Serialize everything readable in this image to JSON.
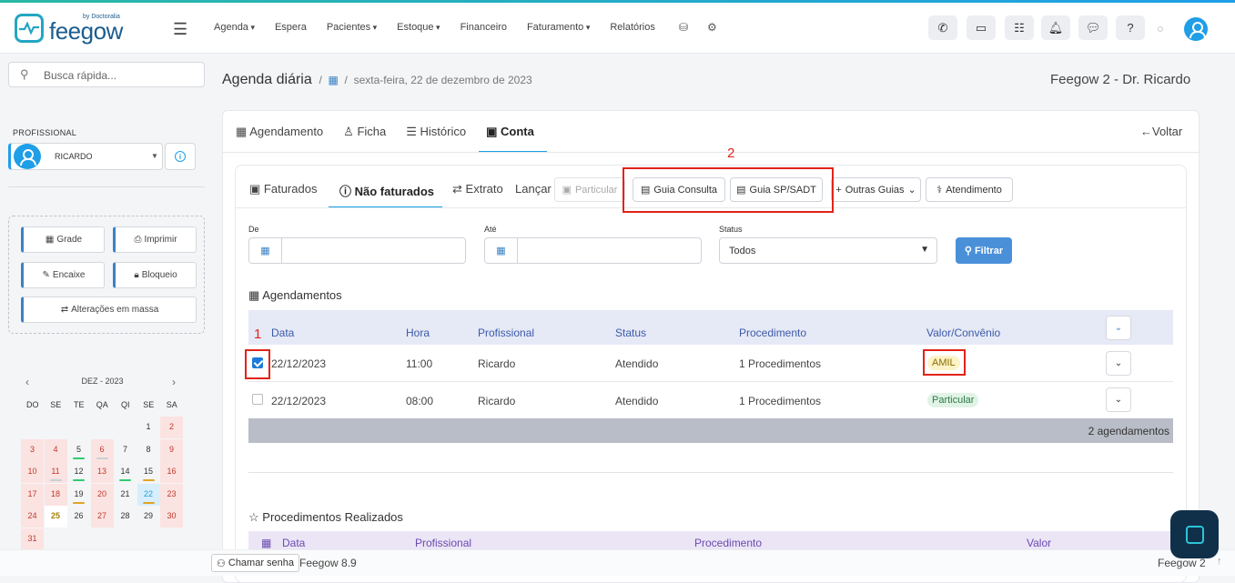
{
  "brand": {
    "name": "feegow",
    "by": "by Doctoralia"
  },
  "nav": {
    "items": [
      {
        "label": "Agenda",
        "caret": true
      },
      {
        "label": "Espera",
        "caret": false
      },
      {
        "label": "Pacientes",
        "caret": true
      },
      {
        "label": "Estoque",
        "caret": true
      },
      {
        "label": "Financeiro",
        "caret": false
      },
      {
        "label": "Faturamento",
        "caret": true
      },
      {
        "label": "Relatórios",
        "caret": false
      }
    ]
  },
  "topbar_icons": [
    "phone-icon",
    "inbox-icon",
    "tasks-icon",
    "bell-icon",
    "chat-icon",
    "help-icon"
  ],
  "sidebar": {
    "search_placeholder": "Busca rápida...",
    "prof_label": "PROFISSIONAL",
    "prof_name": "RICARDO",
    "actions": {
      "grade": "Grade",
      "imprimir": "Imprimir",
      "encaixe": "Encaixe",
      "bloqueio": "Bloqueio",
      "massa": "Alterações em massa"
    },
    "calendar": {
      "month": "DEZ - 2023",
      "dows": [
        "DO",
        "SE",
        "TE",
        "QA",
        "QI",
        "SE",
        "SA"
      ],
      "days": [
        {
          "d": "1"
        },
        {
          "d": "2"
        },
        {
          "d": "3"
        },
        {
          "d": "4"
        },
        {
          "d": "5"
        },
        {
          "d": "6"
        },
        {
          "d": "7"
        },
        {
          "d": "8"
        },
        {
          "d": "9"
        },
        {
          "d": "10"
        },
        {
          "d": "11"
        },
        {
          "d": "12"
        },
        {
          "d": "13"
        },
        {
          "d": "14"
        },
        {
          "d": "15"
        },
        {
          "d": "16"
        },
        {
          "d": "17"
        },
        {
          "d": "18"
        },
        {
          "d": "19"
        },
        {
          "d": "20"
        },
        {
          "d": "21"
        },
        {
          "d": "22"
        },
        {
          "d": "23"
        },
        {
          "d": "24"
        },
        {
          "d": "25"
        },
        {
          "d": "26"
        },
        {
          "d": "27"
        },
        {
          "d": "28"
        },
        {
          "d": "29"
        },
        {
          "d": "30"
        },
        {
          "d": "31"
        }
      ]
    }
  },
  "page": {
    "title": "Agenda diária",
    "breadcrumb_date": "sexta-feira, 22 de dezembro de 2023",
    "right_title": "Feegow 2 - Dr. Ricardo"
  },
  "tabs": {
    "agendamento": "Agendamento",
    "ficha": "Ficha",
    "historico": "Histórico",
    "conta": "Conta",
    "voltar": "Voltar"
  },
  "subtabs": {
    "faturados": "Faturados",
    "nao_faturados": "Não faturados",
    "extrato": "Extrato",
    "lancar": "Lançar"
  },
  "buttons": {
    "particular": "Particular",
    "guia_consulta": "Guia Consulta",
    "guia_sadt": "Guia SP/SADT",
    "outras_guias": "Outras Guias",
    "atendimento": "Atendimento"
  },
  "annotations": {
    "one": "1",
    "two": "2"
  },
  "filters": {
    "de_label": "De",
    "ate_label": "Até",
    "status_label": "Status",
    "status_value": "Todos",
    "filtrar": "Filtrar"
  },
  "agendamentos": {
    "title": "Agendamentos",
    "headers": {
      "data": "Data",
      "hora": "Hora",
      "profissional": "Profissional",
      "status": "Status",
      "procedimento": "Procedimento",
      "valor": "Valor/Convênio"
    },
    "rows": [
      {
        "data": "22/12/2023",
        "hora": "11:00",
        "profissional": "Ricardo",
        "status": "Atendido",
        "procedimento": "1 Procedimentos",
        "valor": "AMIL",
        "checked": true
      },
      {
        "data": "22/12/2023",
        "hora": "08:00",
        "profissional": "Ricardo",
        "status": "Atendido",
        "procedimento": "1 Procedimentos",
        "valor": "Particular",
        "checked": false
      }
    ],
    "total": "2 agendamentos"
  },
  "procedimentos": {
    "title": "Procedimentos Realizados",
    "headers": {
      "data": "Data",
      "profissional": "Profissional",
      "procedimento": "Procedimento",
      "valor": "Valor"
    }
  },
  "footer": {
    "chamar": "Chamar senha",
    "version": "Feegow 8.9",
    "right": "Feegow 2"
  },
  "colors": {
    "accent": "#1e9fe8",
    "annotation": "#e2231a",
    "weekend": "#fbe3e1"
  }
}
